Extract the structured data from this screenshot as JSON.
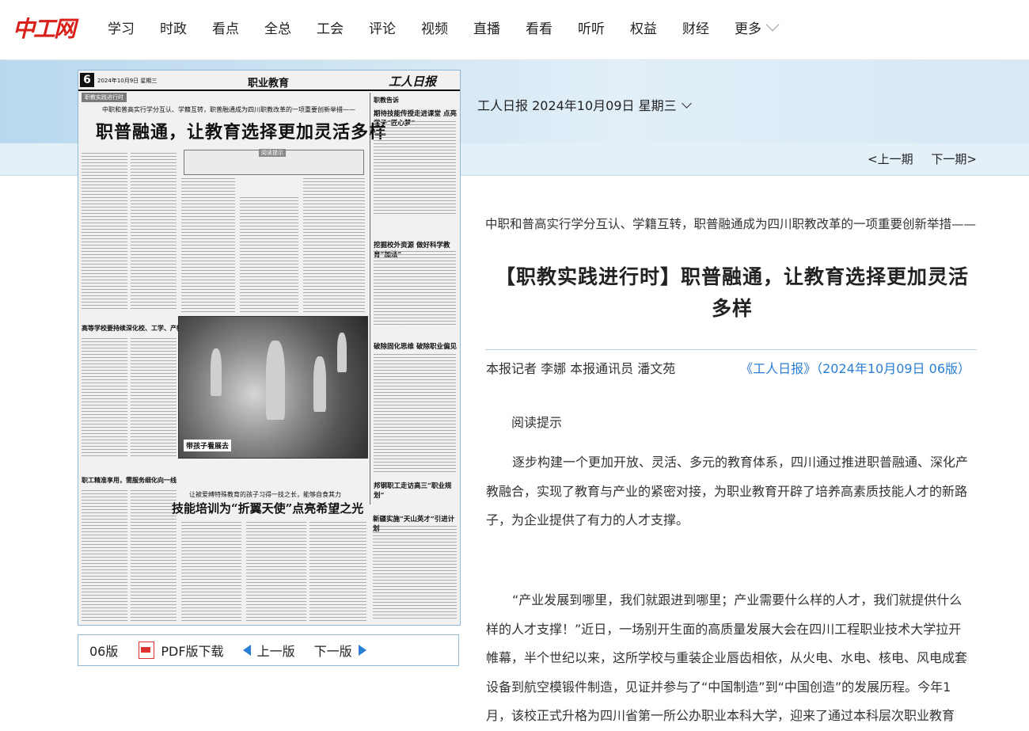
{
  "logo": "中工网",
  "nav": {
    "items": [
      "学习",
      "时政",
      "看点",
      "全总",
      "工会",
      "评论",
      "视频",
      "直播",
      "看看",
      "听听",
      "权益",
      "财经"
    ],
    "more": "更多"
  },
  "edition": {
    "date_label": "工人日报 2024年10月09日 星期三",
    "prev_issue": "<上一期",
    "next_issue": "下一期>"
  },
  "paper_page": {
    "page_number": "6",
    "date": "2024年10月9日  星期三",
    "section": "职业教育",
    "masthead": "工人日报",
    "tag": "职教实践进行时",
    "kicker": "中职和普高实行学分互认、学籍互转，职普融通成为四川职教改革的一项重要创新举措——",
    "headline": "职普融通，让教育选择更加灵活多样",
    "box_label": "阅读提示",
    "photo_caption": "带孩子看展去",
    "sub_left": "高等学校要持续深化校、工学、产教融合",
    "sub_left2": "职工精准享用，需服务细化向一线",
    "right_tag": "职教告诉",
    "right_title_1": "期待技能传授走进课堂 点亮学子“匠心梦”",
    "right_title_2": "挖掘校外资源 做好科学教育“加法”",
    "right_title_3": "破除固化思维 破除职业偏见",
    "right_title_4": "邦钢职工走访高三“职业规划”",
    "right_title_5": "新疆实施“天山英才”引进计划",
    "bottom_kicker": "让被爱缚特殊教育的孩子习得一技之长，能够自食其力",
    "bottom_headline": "技能培训为“折翼天使”点亮希望之光"
  },
  "pager": {
    "page": "06版",
    "pdf": "PDF版下载",
    "prev": "上一版",
    "next": "下一版"
  },
  "article": {
    "kicker": "中职和普高实行学分互认、学籍互转，职普融通成为四川职教改革的一项重要创新举措——",
    "headline": "【职教实践进行时】职普融通，让教育选择更加灵活多样",
    "byline": "本报记者 李娜 本报通讯员 潘文苑",
    "source": "《工人日报》（2024年10月09日 06版）",
    "tips": "阅读提示",
    "p1": "逐步构建一个更加开放、灵活、多元的教育体系，四川通过推进职普融通、深化产教融合，实现了教育与产业的紧密对接，为职业教育开辟了培养高素质技能人才的新路子，为企业提供了有力的人才支撑。",
    "p2": "“产业发展到哪里，我们就跟进到哪里；产业需要什么样的人才，我们就提供什么样的人才支撑！”近日，一场别开生面的高质量发展大会在四川工程职业技术大学拉开帷幕，半个世纪以来，这所学校与重装企业唇齿相依，从火电、水电、核电、风电成套设备到航空模锻件制造，见证并参与了“中国制造”到“中国创造”的发展历程。今年1月，该校正式升格为四川省第一所公办职业本科大学，迎来了通过本科层次职业教育"
  }
}
